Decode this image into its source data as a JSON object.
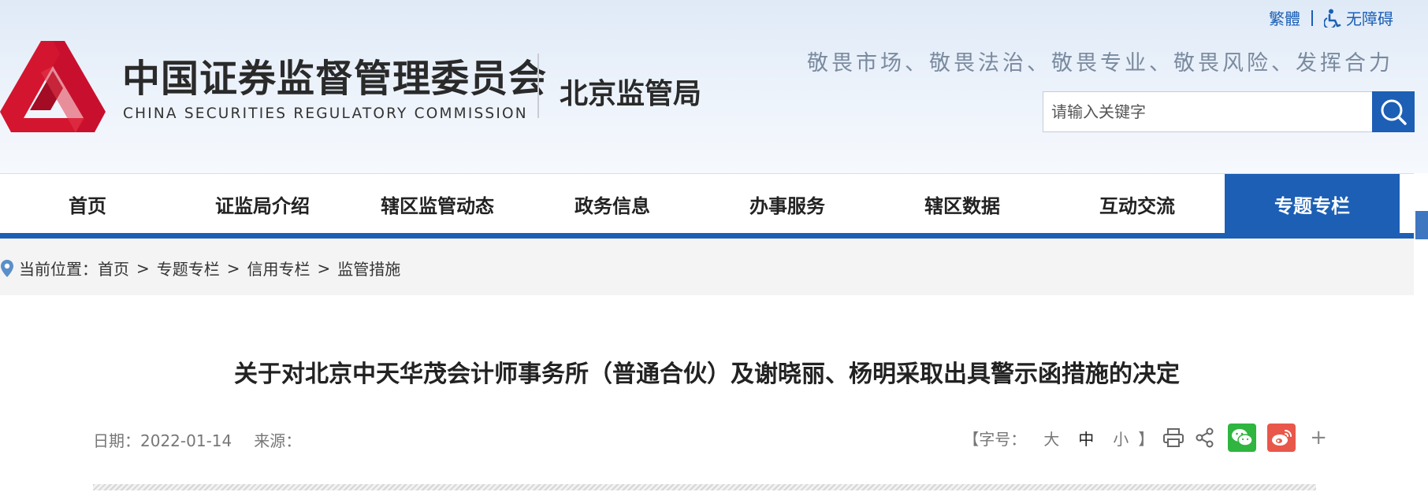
{
  "header": {
    "org_name_cn": "中国证券监督管理委员会",
    "org_name_en": "CHINA SECURITIES REGULATORY COMMISSION",
    "bureau": "北京监管局",
    "slogan": "敬畏市场、敬畏法治、敬畏专业、敬畏风险、发挥合力",
    "links": {
      "traditional": "繁體",
      "accessibility": "无障碍"
    },
    "search": {
      "placeholder": "请输入关键字",
      "value": ""
    }
  },
  "nav": {
    "items": [
      {
        "label": "首页"
      },
      {
        "label": "证监局介绍"
      },
      {
        "label": "辖区监管动态"
      },
      {
        "label": "政务信息"
      },
      {
        "label": "办事服务"
      },
      {
        "label": "辖区数据"
      },
      {
        "label": "互动交流"
      },
      {
        "label": "专题专栏",
        "active": true
      }
    ]
  },
  "breadcrumb": {
    "prefix": "当前位置：",
    "items": [
      "首页",
      "专题专栏",
      "信用专栏",
      "监管措施"
    ],
    "separator": ">"
  },
  "article": {
    "title": "关于对北京中天华茂会计师事务所（普通合伙）及谢晓丽、杨明采取出具警示函措施的决定",
    "date_label": "日期：",
    "date": "2022-01-14",
    "source_label": "来源：",
    "source": "",
    "font_size_label": "【字号：",
    "font_sizes": [
      "大",
      "中",
      "小"
    ],
    "font_size_close": "】",
    "share_more": "+"
  },
  "colors": {
    "brand_blue": "#1c5fb5",
    "logo_red": "#c8102e",
    "wechat_green": "#2fb540",
    "weibo_red": "#e8574a"
  },
  "icons": [
    "logo-mark",
    "accessibility-icon",
    "search-icon",
    "location-pin-icon",
    "print-icon",
    "share-icon",
    "wechat-icon",
    "weibo-icon",
    "plus-icon"
  ]
}
